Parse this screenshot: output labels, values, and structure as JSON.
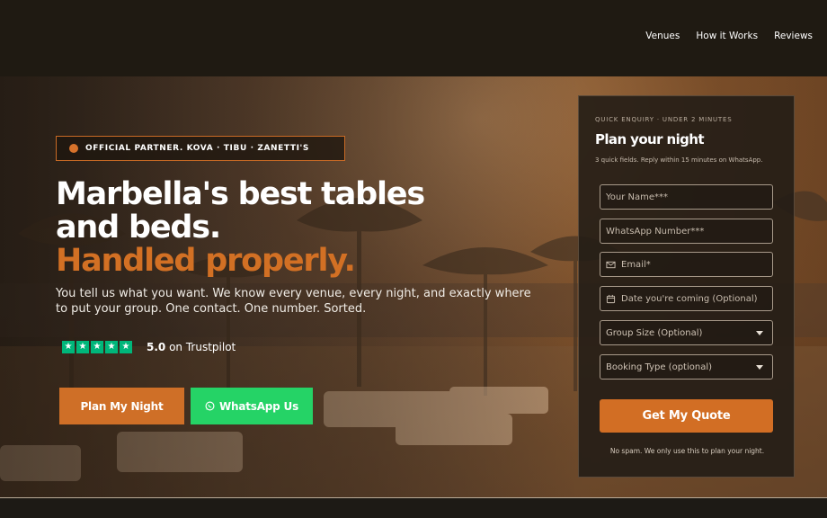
{
  "nav": {
    "items": [
      "Venues",
      "How it Works",
      "Reviews"
    ]
  },
  "hero": {
    "badge": "OFFICIAL PARTNER. KOVA · TIBU · ZANETTI'S",
    "headline_line1": "Marbella's best tables",
    "headline_line2": "and beds.",
    "headline_line3": "Handled properly.",
    "subcopy": "You tell us what you want. We know every venue, every night, and exactly where to put your group. One contact. One number. Sorted.",
    "rating_value": "5.0",
    "rating_source": "on Trustpilot",
    "stars": 5,
    "plan_button": "Plan My Night",
    "whatsapp_button": "WhatsApp Us"
  },
  "form": {
    "kicker": "QUICK ENQUIRY · UNDER 2 MINUTES",
    "title": "Plan your night",
    "subtitle": "3 quick fields. Reply within 15 minutes on WhatsApp.",
    "name_placeholder": "Your Name***",
    "whatsapp_placeholder": "WhatsApp Number***",
    "email_placeholder": "Email*",
    "date_placeholder": "Date you're coming (Optional)",
    "group_size": "Group Size (Optional)",
    "booking_type": "Booking Type (optional)",
    "submit_label": "Get My Quote",
    "fine_print": "No spam. We only use this to plan your night."
  },
  "colors": {
    "accent": "#d26e24",
    "whatsapp": "#25d366",
    "trustpilot": "#00b67a",
    "topbar": "#1f1a12"
  },
  "icons": {
    "email": "mail-icon",
    "date": "calendar-icon",
    "whatsapp": "whatsapp-icon",
    "dropdown": "chevron-down-icon",
    "rating": "star-icon"
  }
}
